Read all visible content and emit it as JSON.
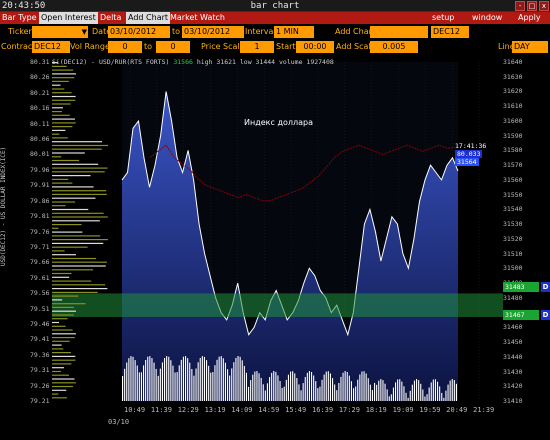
{
  "titlebar": {
    "clock": "20:43:50",
    "title": "bar chart",
    "buttons": [
      {
        "name": "minimize-button",
        "label": "-"
      },
      {
        "name": "maximize-button",
        "label": "□"
      },
      {
        "name": "close-button",
        "label": "x"
      }
    ]
  },
  "menubar": {
    "items": [
      {
        "name": "menu-bar-type",
        "label": "Bar Type",
        "active": false
      },
      {
        "name": "menu-open-interest",
        "label": "Open Interest",
        "active": true
      },
      {
        "name": "menu-delta",
        "label": "Delta",
        "active": false
      },
      {
        "name": "menu-add-chart",
        "label": "Add Chart",
        "active": true
      },
      {
        "name": "menu-market-watch",
        "label": "Market Watch",
        "active": false
      }
    ],
    "right_items": [
      {
        "name": "menu-setup",
        "label": "setup"
      },
      {
        "name": "menu-window",
        "label": "window"
      },
      {
        "name": "menu-apply",
        "label": "Apply"
      }
    ]
  },
  "controls": {
    "ticker_label": "Ticker",
    "ticker_value": "",
    "date_label": "Date",
    "date_from": "03/10/2012",
    "date_to_label": "to",
    "date_to": "03/10/2012",
    "interval_label": "Interval",
    "interval_value": "1 MIN",
    "add_chart_label": "Add Chart",
    "add_chart_value": "",
    "add_chart_contract": "DEC12",
    "contract_label": "Contract",
    "contract_value": "DEC12",
    "vol_range_label": "Vol Range",
    "vol_range_from": "0",
    "vol_range_to_label": "to",
    "vol_range_to": "0",
    "price_scale_label": "Price Scale",
    "price_scale_value": "1",
    "start_label": "Start",
    "start_value": "00:00",
    "add_scale_label": "Add Scale",
    "add_scale_value": "0.005",
    "line_label": "Line",
    "line_value": "DAY"
  },
  "chart_header": {
    "symbol": "Si(DEC12) - USD/RUR(RTS FORTS)",
    "last": "31566",
    "rest": "high 31621  low 31444  volume 1927408"
  },
  "annotation": "Индекс доллара",
  "vertical_label": "USD(DEC12) - US DOLLAR INDEX(ICE)",
  "right_badges": {
    "time": "17:41:36",
    "dx_value": "80.033",
    "si_value": "31564",
    "green1": "31483",
    "green2": "31467",
    "tag": "D"
  },
  "date_label": "03/10",
  "colors": {
    "accent_orange": "#ff9a00",
    "menu_red": "#b11a12",
    "area_blue": "#2a3f9a",
    "index_line": "#8b0000",
    "green_band": "#1f8f3a",
    "volume_profile_green": "#8a8f1f",
    "volume_profile_white": "#ffffff"
  },
  "chart_data": {
    "type": "line",
    "left_axis_ticks": [
      "80.31",
      "80.26",
      "80.21",
      "80.16",
      "80.11",
      "80.06",
      "80.01",
      "79.96",
      "79.91",
      "79.86",
      "79.81",
      "79.76",
      "79.71",
      "79.66",
      "79.61",
      "79.56",
      "79.51",
      "79.46",
      "79.41",
      "79.36",
      "79.31",
      "79.26",
      "79.21"
    ],
    "right_axis_ticks": [
      "31640",
      "31630",
      "31620",
      "31610",
      "31600",
      "31590",
      "31580",
      "31570",
      "31560",
      "31550",
      "31540",
      "31530",
      "31520",
      "31510",
      "31500",
      "31490",
      "31480",
      "31470",
      "31460",
      "31450",
      "31440",
      "31430",
      "31420",
      "31410"
    ],
    "x_ticks": [
      "10:49",
      "11:39",
      "12:29",
      "13:19",
      "14:09",
      "14:59",
      "15:49",
      "16:39",
      "17:29",
      "18:19",
      "19:09",
      "19:59",
      "20:49",
      "21:39"
    ],
    "series": [
      {
        "name": "Si(DEC12)",
        "values": [
          31560,
          31565,
          31595,
          31600,
          31575,
          31555,
          31570,
          31590,
          31620,
          31600,
          31575,
          31565,
          31580,
          31560,
          31530,
          31510,
          31495,
          31480,
          31470,
          31465,
          31475,
          31490,
          31470,
          31455,
          31460,
          31470,
          31465,
          31478,
          31485,
          31475,
          31465,
          31470,
          31478,
          31490,
          31500,
          31495,
          31485,
          31480,
          31470,
          31475,
          31465,
          31455,
          31470,
          31500,
          31530,
          31540,
          31525,
          31505,
          31520,
          31535,
          31530,
          31510,
          31500,
          31520,
          31545,
          31560,
          31570,
          31565,
          31560,
          31570,
          31575,
          31566
        ]
      },
      {
        "name": "USD Index",
        "values": [
          80.0,
          80.02,
          80.04,
          80.0,
          79.98,
          79.96,
          79.93,
          79.91,
          79.9,
          79.89,
          79.88,
          79.87,
          79.88,
          79.87,
          79.86,
          79.86,
          79.87,
          79.88,
          79.89,
          79.9,
          79.92,
          79.94,
          79.97,
          80.0,
          80.02,
          80.03,
          80.04,
          80.03,
          80.02,
          80.01,
          80.02,
          80.03,
          80.04,
          80.03,
          80.02,
          80.03,
          80.04,
          80.03,
          80.033
        ]
      }
    ],
    "green_band": [
      31467,
      31483
    ]
  }
}
